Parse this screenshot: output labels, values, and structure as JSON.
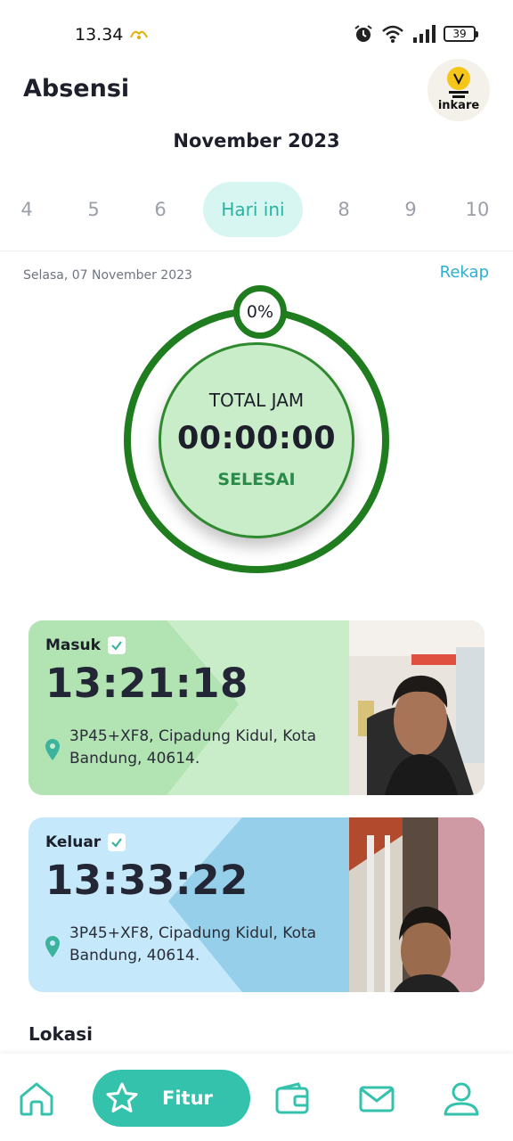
{
  "status_bar": {
    "time": "13.34",
    "battery": "39"
  },
  "header": {
    "title": "Absensi",
    "avatar_text": "inkare"
  },
  "calendar": {
    "month": "November 2023",
    "days": [
      "4",
      "5",
      "6",
      "Hari ini",
      "8",
      "9",
      "10"
    ],
    "selected_date": "Selasa, 07 November 2023",
    "rekap_label": "Rekap"
  },
  "summary": {
    "percent": "0%",
    "total_label": "TOTAL JAM",
    "total_value": "00:00:00",
    "status": "SELESAI"
  },
  "check_in": {
    "label": "Masuk",
    "time": "13:21:18",
    "location": "3P45+XF8, Cipadung Kidul, Kota Bandung, 40614."
  },
  "check_out": {
    "label": "Keluar",
    "time": "13:33:22",
    "location": "3P45+XF8, Cipadung Kidul, Kota Bandung, 40614."
  },
  "section": {
    "lokasi": "Lokasi"
  },
  "nav": {
    "fitur_label": "Fitur",
    "icons": [
      "home-icon",
      "star-icon",
      "wallet-icon",
      "mail-icon",
      "profile-icon"
    ]
  },
  "colors": {
    "accent": "#35c2ad",
    "ring": "#1f7d1f",
    "check_in_card": "#c9ecc9",
    "check_out_card": "#c5e9fa",
    "link": "#2faed0"
  }
}
